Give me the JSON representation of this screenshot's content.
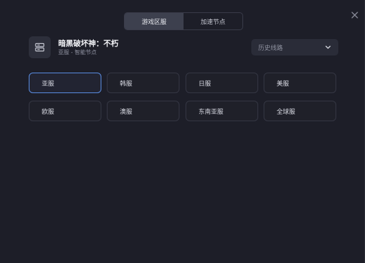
{
  "tabs": [
    {
      "label": "游戏区服",
      "active": true
    },
    {
      "label": "加速节点",
      "active": false
    }
  ],
  "game": {
    "title": "暗黑破坏神：不朽",
    "subtitle": "亚服 - 智能节点"
  },
  "history_dropdown": {
    "placeholder": "历史线路"
  },
  "regions": [
    {
      "label": "亚服",
      "selected": true
    },
    {
      "label": "韩服",
      "selected": false
    },
    {
      "label": "日服",
      "selected": false
    },
    {
      "label": "美服",
      "selected": false
    },
    {
      "label": "欧服",
      "selected": false
    },
    {
      "label": "澳服",
      "selected": false
    },
    {
      "label": "东南亚服",
      "selected": false
    },
    {
      "label": "全球服",
      "selected": false
    }
  ],
  "colors": {
    "background": "#1d1e28",
    "selected_border": "#5b8fe6",
    "active_tab": "#3d404e"
  },
  "icons": {
    "close": "close-icon",
    "game": "server-icon",
    "dropdown": "chevron-down-icon"
  }
}
